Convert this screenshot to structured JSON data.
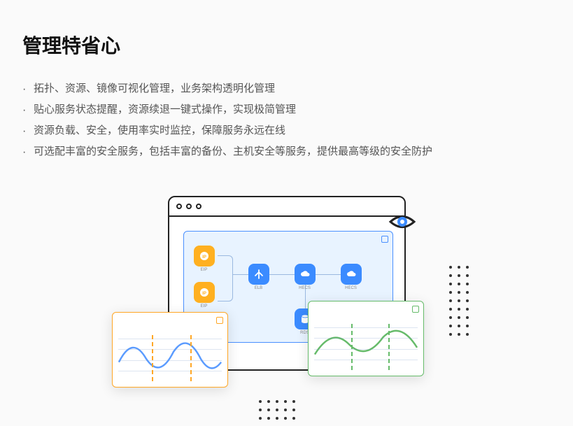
{
  "heading": "管理特省心",
  "bullets": [
    "拓扑、资源、镜像可视化管理，业务架构透明化管理",
    "贴心服务状态提醒，资源续退一键式操作，实现极简管理",
    "资源负载、安全，使用率实时监控，保障服务永远在线",
    "可选配丰富的安全服务，包括丰富的备份、主机安全等服务，提供最高等级的安全防护"
  ],
  "diagram": {
    "nodes": {
      "eip1": "EIP",
      "eip2": "EIP",
      "elb": "ELB",
      "hecs1": "HECS",
      "hecs2": "HECS",
      "rds": "RDS"
    }
  }
}
